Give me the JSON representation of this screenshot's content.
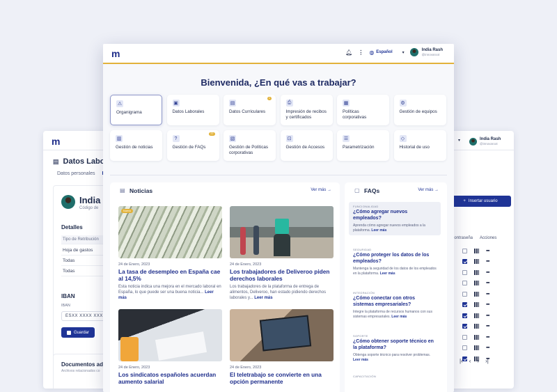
{
  "left_window": {
    "logo": "m",
    "title": "Datos Labora",
    "tabs": [
      "Datos personales",
      "D"
    ],
    "profile_name": "India",
    "profile_sub": "Código de",
    "details_title": "Detalles",
    "rows": [
      "Tipo de Retribución",
      "Hoja de gastos",
      "Todas",
      "Todas"
    ],
    "iban_title": "IBAN",
    "iban_label": "IBAN",
    "iban_value": "ESXX  XXXX  XXXX",
    "save_label": "Guardar",
    "docs_title": "Documentos adju",
    "docs_sub": "Archivos relacionados co"
  },
  "right_window": {
    "user_name": "India Rash",
    "user_email": "@innovaroot",
    "insert_label": "Insertar usuario",
    "col_password": "Contraseña",
    "col_actions": "Acciones",
    "rows_checked": [
      false,
      true,
      false,
      false,
      false,
      true,
      true,
      true,
      false,
      false,
      true
    ],
    "pager": [
      "|‹",
      "‹",
      "›",
      "›|"
    ]
  },
  "header": {
    "logo": "m",
    "language": "Español",
    "user_name": "India Rash",
    "user_email": "@innovaroot",
    "bell_icon": "bell-icon",
    "menu_icon": "kebab-icon",
    "globe_icon": "globe-icon"
  },
  "welcome": "Bienvenida, ¿En qué vas a trabajar?",
  "tiles": [
    {
      "label": "Organigrama",
      "icon": "org-icon",
      "badge": ""
    },
    {
      "label": "Datos Laborales",
      "icon": "briefcase-icon",
      "badge": ""
    },
    {
      "label": "Datos Curriculares",
      "icon": "document-icon",
      "badge": "1"
    },
    {
      "label": "Impresión de recibos y certificados",
      "icon": "print-icon",
      "badge": ""
    },
    {
      "label": "Políticas corporativas",
      "icon": "policy-icon",
      "badge": ""
    },
    {
      "label": "Gestión de equipos",
      "icon": "team-icon",
      "badge": ""
    },
    {
      "label": "Gestión de noticias",
      "icon": "news-icon",
      "badge": ""
    },
    {
      "label": "Gestión de FAQs",
      "icon": "faq-icon",
      "badge": "22"
    },
    {
      "label": "Gestión de Políticas corporativas",
      "icon": "policy-manage-icon",
      "badge": ""
    },
    {
      "label": "Gestión de Accesos",
      "icon": "access-icon",
      "badge": ""
    },
    {
      "label": "Parametrización",
      "icon": "sliders-icon",
      "badge": ""
    },
    {
      "label": "Historial de uso",
      "icon": "history-icon",
      "badge": ""
    }
  ],
  "news": {
    "title": "Noticias",
    "see_more": "Ver más →",
    "badge_new": "Nuevo",
    "items": [
      {
        "date": "24 de Enero, 2023",
        "title": "La tasa de desempleo en España cae al 14,5%",
        "desc": "Esta noticia indica una mejora en el mercado laboral en España, lo que puede ser una buena noticia...",
        "read": "Leer más"
      },
      {
        "date": "24 de Enero, 2023",
        "title": "Los trabajadores de Deliveroo piden derechos laborales",
        "desc": "Los trabajadores de la plataforma de entrega de alimentos, Deliveroo, han estado pidiendo derechos laborales y...",
        "read": "Leer más"
      },
      {
        "date": "24 de Enero, 2023",
        "title": "Los sindicatos españoles acuerdan aumento salarial",
        "desc": "",
        "read": ""
      },
      {
        "date": "24 de Enero, 2023",
        "title": "El teletrabajo se convierte en una opción permanente",
        "desc": "",
        "read": ""
      }
    ]
  },
  "faqs": {
    "title": "FAQs",
    "see_more": "Ver más →",
    "items": [
      {
        "category": "FUNCIONALIDAD",
        "question": "¿Cómo agregar nuevos empleados?",
        "answer": "Aprenda cómo agregar nuevos empleados a la plataforma.",
        "read": "Leer más"
      },
      {
        "category": "SEGURIDAD",
        "question": "¿Cómo proteger los datos de los empleados?",
        "answer": "Mantenga la seguridad de los datos de los empleados en la plataforma.",
        "read": "Leer más"
      },
      {
        "category": "INTEGRACIÓN",
        "question": "¿Cómo conectar con otros sistemas empresariales?",
        "answer": "Integre la plataforma de recursos humanos con sus sistemas empresariales.",
        "read": "Leer más"
      },
      {
        "category": "SOPORTE",
        "question": "¿Cómo obtener soporte técnico en la plataforma?",
        "answer": "Obtenga soporte técnico para resolver problemas.",
        "read": "Leer más"
      },
      {
        "category": "CAPACITACIÓN",
        "question": "",
        "answer": "",
        "read": ""
      }
    ]
  }
}
